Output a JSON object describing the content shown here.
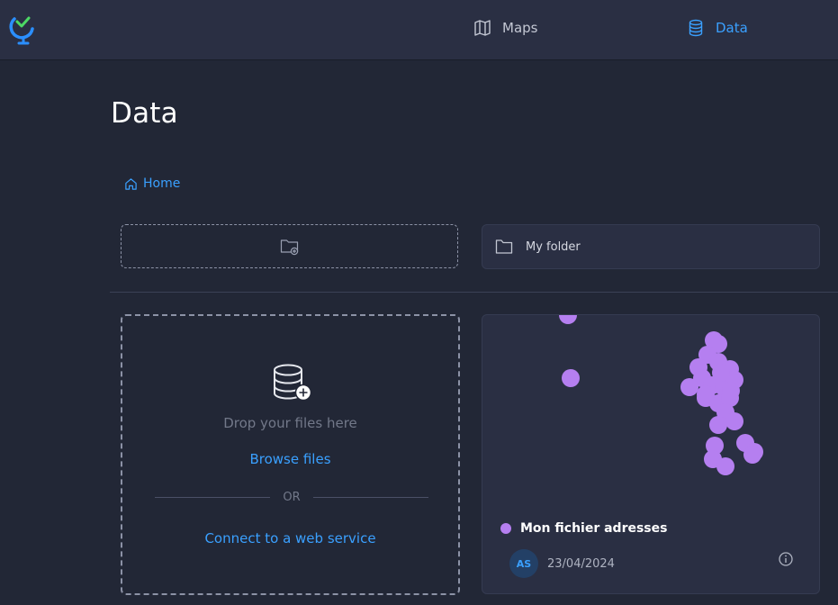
{
  "nav": {
    "maps_label": "Maps",
    "data_label": "Data",
    "active": "Data"
  },
  "page": {
    "title": "Data"
  },
  "breadcrumb": {
    "home_label": "Home"
  },
  "folders": [
    {
      "name": "My folder"
    }
  ],
  "upload": {
    "drop_text": "Drop your files here",
    "browse_label": "Browse files",
    "or_label": "OR",
    "connect_label": "Connect to a web service"
  },
  "dataset": {
    "name": "Mon fichier adresses",
    "color": "#b57ff0",
    "owner_initials": "AS",
    "date": "23/04/2024"
  },
  "colors": {
    "accent": "#3aa0ff",
    "background": "#222736",
    "panel": "#2a2f43",
    "point": "#b57ff0"
  },
  "icons": [
    "logo-icon",
    "map-icon",
    "database-icon",
    "home-icon",
    "folder-add-icon",
    "folder-icon",
    "database-upload-icon",
    "info-icon"
  ]
}
